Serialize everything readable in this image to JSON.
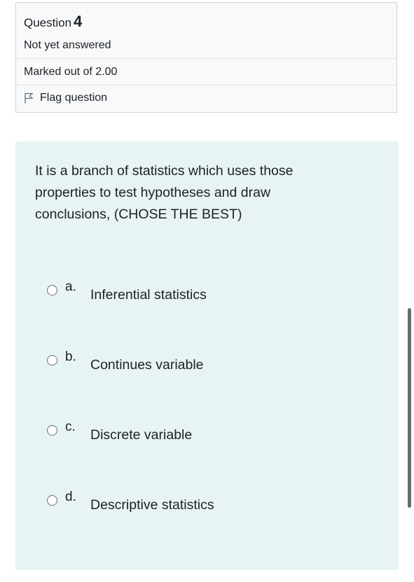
{
  "info": {
    "question_label": "Question",
    "question_number": "4",
    "state": "Not yet answered",
    "grade": "Marked out of 2.00",
    "flag_label": "Flag question"
  },
  "question": {
    "text": "It is a branch of statistics which uses those properties to test hypotheses and draw conclusions, (CHOSE THE BEST)"
  },
  "options": [
    {
      "letter": "a.",
      "text": "Inferential statistics",
      "selected": false
    },
    {
      "letter": "b.",
      "text": "Continues variable",
      "selected": false
    },
    {
      "letter": "c.",
      "text": "Discrete variable",
      "selected": false
    },
    {
      "letter": "d.",
      "text": "Descriptive statistics",
      "selected": false
    }
  ],
  "icons": {
    "flag": "flag-icon",
    "radio": "radio-icon"
  },
  "colors": {
    "info_background": "#f8f9fa",
    "content_background": "#e7f3f5",
    "text": "#1d2125",
    "border": "#cfd4d9",
    "scrollbar": "#6b6b6b"
  }
}
